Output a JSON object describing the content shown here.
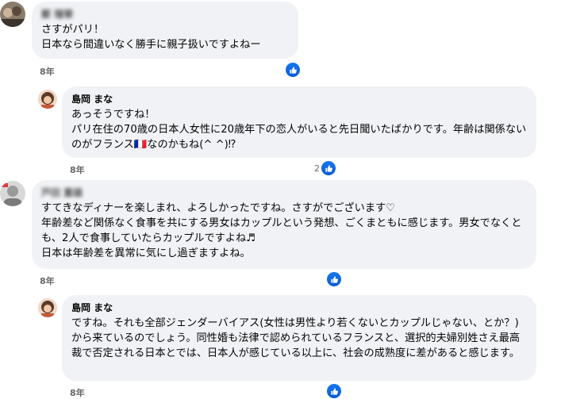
{
  "comments": [
    {
      "author": "鄭 瑠華",
      "text": "さすがパリ！\n日本なら間違いなく勝手に親子扱いですよねー",
      "time": "8年",
      "reactions": "",
      "like_icon": "thumbs-up-icon"
    },
    {
      "author": "島岡 まな",
      "text": "あっそうですね！\nパリ在住の70歳の日本人女性に20歳年下の恋人がいると先日聞いたばかりです。年齢は関係ないのがフランス🇫🇷なのかもね(^ ^)⁉",
      "time": "8年",
      "reactions": "2",
      "like_icon": "thumbs-up-icon"
    },
    {
      "author": "戸田 重雄",
      "text": "すてきなディナーを楽しまれ、よろしかったですね。さすがでございます♡\n年齢差など関係なく食事を共にする男女はカップルという発想、ごくまともに感じます。男女でなくとも、2人で食事していたらカップルですよね♬\n日本は年齢差を異常に気にし過ぎますよね。",
      "time": "8年",
      "reactions": "",
      "like_icon": "thumbs-up-icon"
    },
    {
      "author": "島岡 まな",
      "text": "ですね。それも全部ジェンダーバイアス(女性は男性より若くないとカップルじゃない、とか？)から来ているのでしょう。同性婚も法律で認められているフランスと、選択的夫婦別姓さえ最高裁で否定される日本とでは、日本人が感じている以上に、社会の成熟度に差があると感じます。",
      "time": "8年",
      "reactions": "",
      "like_icon": "thumbs-up-icon"
    }
  ],
  "colors": {
    "like_blue": "#1877f2",
    "bubble_bg": "#f0f2f5",
    "meta_gray": "#65676b"
  }
}
